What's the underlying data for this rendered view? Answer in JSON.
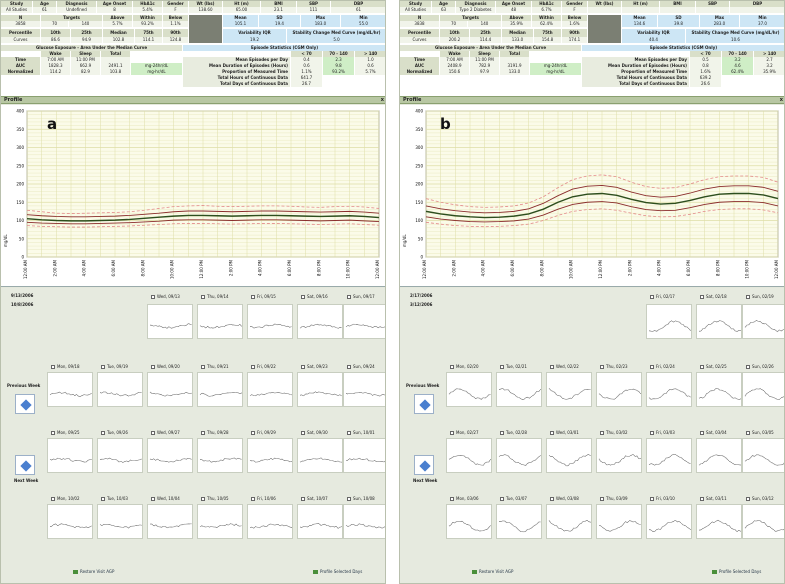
{
  "panels": [
    {
      "letter": "a",
      "stats_header": [
        "Study",
        "Age",
        "Diagnosis",
        "Age Onset",
        "HbA1c",
        "Gender",
        "Wt (lbs)",
        "Ht (m)",
        "BMI",
        "SBP",
        "DBP"
      ],
      "stats_values": [
        "All Studies",
        "61",
        "Undefined",
        "8",
        "5.4%",
        "F",
        "138.60",
        "65.00",
        "23.1",
        "111",
        "61"
      ],
      "range_header": [
        "N",
        "Targets",
        "Above",
        "Within",
        "Below",
        "Mean",
        "SD",
        "Max",
        "Min"
      ],
      "range_values": [
        "3858",
        "70",
        "140",
        "5.7%",
        "93.2%",
        "1.1%",
        "105.1",
        "19.4",
        "183.0",
        "55.0"
      ],
      "percentile_header": [
        "Percentile",
        "10th",
        "25th",
        "Median",
        "75th",
        "90th",
        "Variability IQR",
        "Stability Change Med Curve (mg/dL/hr)"
      ],
      "percentile_values": [
        "Curves",
        "86.6",
        "94.9",
        "102.8",
        "114.1",
        "124.8",
        "19.2",
        "5.0"
      ],
      "glucose_title": "Glucose Exposure - Area Under the Median Curve",
      "glucose_cols": [
        "Wake",
        "Sleep",
        "Total"
      ],
      "glucose_time": [
        "Time",
        "7:00 AM",
        "11:00 PM",
        ""
      ],
      "glucose_auc": [
        "AUC",
        "1828.3",
        "662.9",
        "2491.1",
        "mg-24hr/dL"
      ],
      "glucose_norm": [
        "Normalized",
        "114.2",
        "82.9",
        "103.8",
        "mg-hr/dL"
      ],
      "episode_title": "Episode Statistics (CGM Only)",
      "episode_cols": [
        "< 70",
        "70 - 140",
        "> 140"
      ],
      "episode_rows": [
        {
          "label": "Mean Episodes per Day",
          "v": [
            "0.4",
            "2.3",
            "1.0"
          ]
        },
        {
          "label": "Mean Duration of Episodes (Hours)",
          "v": [
            "0.6",
            "9.8",
            "0.6"
          ]
        },
        {
          "label": "Proportion of Measured Time",
          "v": [
            "1.1%",
            "93.2%",
            "5.7%"
          ]
        }
      ],
      "total_hours_label": "Total Hours of Continuous Data",
      "total_hours": "641.7",
      "total_days_label": "Total Days of Continuous Data",
      "total_days": "26.7",
      "profile_label": "Profile",
      "profile_close": "x",
      "chart_data": {
        "type": "line",
        "ylabel": "mg/dL",
        "yticks": [
          "0",
          "50",
          "100",
          "150",
          "200",
          "250",
          "300",
          "350",
          "400"
        ],
        "ylim": [
          0,
          400
        ],
        "xticks": [
          "12:00 AM",
          "2:00 AM",
          "4:00 AM",
          "6:00 AM",
          "8:00 AM",
          "10:00 AM",
          "12:00 PM",
          "2:00 PM",
          "4:00 PM",
          "6:00 PM",
          "8:00 PM",
          "10:00 PM",
          "12:00 AM"
        ],
        "x_hours": [
          0,
          1,
          2,
          3,
          4,
          5,
          6,
          7,
          8,
          9,
          10,
          11,
          12,
          13,
          14,
          15,
          16,
          17,
          18,
          19,
          20,
          21,
          22,
          23,
          24
        ],
        "series": [
          {
            "kind": "p90",
            "values": [
              128,
              124,
              120,
              119,
              120,
              121,
              122,
              124,
              128,
              133,
              138,
              140,
              141,
              139,
              138,
              139,
              140,
              140,
              139,
              137,
              136,
              138,
              139,
              137,
              133
            ]
          },
          {
            "kind": "p75",
            "values": [
              116,
              113,
              111,
              110,
              110,
              111,
              112,
              114,
              117,
              120,
              124,
              126,
              126,
              125,
              124,
              125,
              126,
              126,
              125,
              124,
              123,
              124,
              125,
              123,
              120
            ]
          },
          {
            "kind": "median",
            "values": [
              105,
              102,
              100,
              99,
              99,
              100,
              101,
              103,
              106,
              109,
              112,
              114,
              114,
              113,
              112,
              113,
              114,
              114,
              113,
              112,
              111,
              112,
              113,
              111,
              108
            ]
          },
          {
            "kind": "p25",
            "values": [
              95,
              93,
              92,
              91,
              91,
              92,
              93,
              94,
              96,
              98,
              101,
              102,
              102,
              101,
              100,
              101,
              102,
              102,
              101,
              100,
              99,
              100,
              101,
              99,
              97
            ]
          },
          {
            "kind": "p10",
            "values": [
              86,
              84,
              83,
              82,
              82,
              83,
              84,
              85,
              87,
              89,
              91,
              92,
              92,
              91,
              90,
              91,
              92,
              92,
              91,
              90,
              89,
              90,
              91,
              89,
              87
            ]
          }
        ],
        "grid": true
      },
      "date_range": [
        "9/13/2006",
        "10/8/2006"
      ],
      "weeks": [
        {
          "days": [
            null,
            null,
            "Wed, 09/13",
            "Thu, 09/14",
            "Fri, 09/15",
            "Sat, 09/16",
            "Sun, 09/17"
          ],
          "thumbs": [
            0,
            0,
            1,
            1,
            1,
            1,
            1
          ]
        },
        {
          "days": [
            "Mon, 09/18",
            "Tue, 09/19",
            "Wed, 09/20",
            "Thu, 09/21",
            "Fri, 09/22",
            "Sat, 09/23",
            "Sun, 09/24"
          ],
          "thumbs": [
            1,
            1,
            1,
            1,
            1,
            1,
            1
          ]
        },
        {
          "days": [
            "Mon, 09/25",
            "Tue, 09/26",
            "Wed, 09/27",
            "Thu, 09/28",
            "Fri, 09/29",
            "Sat, 09/30",
            "Sun, 10/01"
          ],
          "thumbs": [
            1,
            1,
            1,
            1,
            1,
            1,
            1
          ]
        },
        {
          "days": [
            "Mon, 10/02",
            "Tue, 10/03",
            "Wed, 10/04",
            "Thu, 10/05",
            "Fri, 10/06",
            "Sat, 10/07",
            "Sun, 10/08"
          ],
          "thumbs": [
            1,
            1,
            1,
            1,
            1,
            1,
            1
          ]
        }
      ],
      "prev_week": "Previous Week",
      "next_week": "Next Week",
      "restore": "Restore Visit AGP",
      "profile_selected": "Profile Selected Days"
    },
    {
      "letter": "b",
      "stats_header": [
        "Study",
        "Age",
        "Diagnosis",
        "Age Onset",
        "HbA1c",
        "Gender",
        "Wt (lbs)",
        "Ht (m)",
        "BMI",
        "SBP",
        "DBP"
      ],
      "stats_values": [
        "All Studies",
        "63",
        "Type 2 Diabetes",
        "48",
        "6.7%",
        "F",
        "",
        "",
        "",
        "",
        ""
      ],
      "range_header": [
        "N",
        "Targets",
        "Above",
        "Within",
        "Below",
        "Mean",
        "SD",
        "Max",
        "Min"
      ],
      "range_values": [
        "3838",
        "70",
        "140",
        "35.9%",
        "62.4%",
        "1.6%",
        "134.6",
        "39.8",
        "283.0",
        "37.0"
      ],
      "percentile_header": [
        "Percentile",
        "10th",
        "25th",
        "Median",
        "75th",
        "90th",
        "Variability IQR",
        "Stability Change Med Curve (mg/dL/hr)"
      ],
      "percentile_values": [
        "Curves",
        "200.2",
        "114.4",
        "133.0",
        "154.8",
        "174.1",
        "40.4",
        "10.6"
      ],
      "glucose_title": "Glucose Exposure - Area Under the Median Curve",
      "glucose_cols": [
        "Wake",
        "Sleep",
        "Total"
      ],
      "glucose_time": [
        "Time",
        "7:00 AM",
        "11:00 PM",
        ""
      ],
      "glucose_auc": [
        "AUC",
        "2408.9",
        "782.9",
        "3191.9",
        "mg-24hr/dL"
      ],
      "glucose_norm": [
        "Normalized",
        "150.6",
        "97.9",
        "133.0",
        "mg-hr/dL"
      ],
      "episode_title": "Episode Statistics (CGM Only)",
      "episode_cols": [
        "< 70",
        "70 - 140",
        "> 140"
      ],
      "episode_rows": [
        {
          "label": "Mean Episodes per Day",
          "v": [
            "0.5",
            "3.2",
            "2.7"
          ]
        },
        {
          "label": "Mean Duration of Episodes (Hours)",
          "v": [
            "0.8",
            "4.6",
            "3.2"
          ]
        },
        {
          "label": "Proportion of Measured Time",
          "v": [
            "1.6%",
            "62.4%",
            "35.9%"
          ]
        }
      ],
      "total_hours_label": "Total Hours of Continuous Data",
      "total_hours": "639.2",
      "total_days_label": "Total Days of Continuous Data",
      "total_days": "26.6",
      "profile_label": "Profile",
      "profile_close": "x",
      "chart_data": {
        "type": "line",
        "ylabel": "mg/dL",
        "yticks": [
          "0",
          "50",
          "100",
          "150",
          "200",
          "250",
          "300",
          "350",
          "400"
        ],
        "ylim": [
          0,
          400
        ],
        "xticks": [
          "12:00 AM",
          "2:00 AM",
          "4:00 AM",
          "6:00 AM",
          "8:00 AM",
          "10:00 AM",
          "12:00 PM",
          "2:00 PM",
          "4:00 PM",
          "6:00 PM",
          "8:00 PM",
          "10:00 PM",
          "12:00 AM"
        ],
        "x_hours": [
          0,
          1,
          2,
          3,
          4,
          5,
          6,
          7,
          8,
          9,
          10,
          11,
          12,
          13,
          14,
          15,
          16,
          17,
          18,
          19,
          20,
          21,
          22,
          23,
          24
        ],
        "series": [
          {
            "kind": "p90",
            "values": [
              160,
              150,
              143,
              138,
              136,
              137,
              140,
              148,
              165,
              190,
              212,
              222,
              225,
              220,
              205,
              193,
              188,
              190,
              200,
              212,
              220,
              222,
              222,
              218,
              205
            ]
          },
          {
            "kind": "p75",
            "values": [
              140,
              132,
              127,
              123,
              121,
              122,
              125,
              132,
              147,
              168,
              186,
              194,
              196,
              191,
              178,
              168,
              164,
              166,
              175,
              186,
              193,
              195,
              195,
              191,
              180
            ]
          },
          {
            "kind": "median",
            "values": [
              125,
              118,
              113,
              110,
              108,
              109,
              112,
              118,
              131,
              150,
              165,
              172,
              174,
              169,
              158,
              149,
              145,
              147,
              155,
              165,
              172,
              174,
              174,
              170,
              160
            ]
          },
          {
            "kind": "p25",
            "values": [
              110,
              104,
              100,
              97,
              96,
              97,
              99,
              104,
              115,
              131,
              144,
              150,
              152,
              148,
              138,
              130,
              127,
              128,
              135,
              144,
              150,
              152,
              152,
              149,
              140
            ]
          },
          {
            "kind": "p10",
            "values": [
              95,
              90,
              86,
              84,
              83,
              84,
              86,
              90,
              100,
              114,
              125,
              130,
              132,
              128,
              120,
              113,
              110,
              111,
              117,
              125,
              130,
              132,
              132,
              129,
              121
            ]
          }
        ],
        "grid": true
      },
      "date_range": [
        "2/17/2006",
        "3/12/2006"
      ],
      "weeks": [
        {
          "days": [
            null,
            null,
            null,
            null,
            "Fri, 02/17",
            "Sat, 02/18",
            "Sun, 02/19"
          ],
          "thumbs": [
            0,
            0,
            0,
            0,
            1,
            1,
            1
          ]
        },
        {
          "days": [
            "Mon, 02/20",
            "Tue, 02/21",
            "Wed, 02/22",
            "Thu, 02/23",
            "Fri, 02/24",
            "Sat, 02/25",
            "Sun, 02/26"
          ],
          "thumbs": [
            1,
            1,
            1,
            1,
            1,
            1,
            1
          ]
        },
        {
          "days": [
            "Mon, 02/27",
            "Tue, 02/28",
            "Wed, 03/01",
            "Thu, 03/02",
            "Fri, 03/03",
            "Sat, 03/04",
            "Sun, 03/05"
          ],
          "thumbs": [
            1,
            1,
            1,
            1,
            1,
            1,
            1
          ]
        },
        {
          "days": [
            "Mon, 03/06",
            "Tue, 03/07",
            "Wed, 03/08",
            "Thu, 03/09",
            "Fri, 03/10",
            "Sat, 03/11",
            "Sun, 03/12"
          ],
          "thumbs": [
            1,
            1,
            1,
            1,
            1,
            1,
            1
          ]
        }
      ],
      "prev_week": "Previous Week",
      "next_week": "Next Week",
      "restore": "Restore Visit AGP",
      "profile_selected": "Profile Selected Days"
    }
  ],
  "colors": {
    "chart_bg": "#fbfbe9",
    "grid": "#dedea6",
    "median": "#2d4e1e",
    "quartile": "#8b2d2d",
    "decile": "#e38a8a",
    "accent_blue": "#cde6f5",
    "accent_green": "#cfeec6"
  }
}
